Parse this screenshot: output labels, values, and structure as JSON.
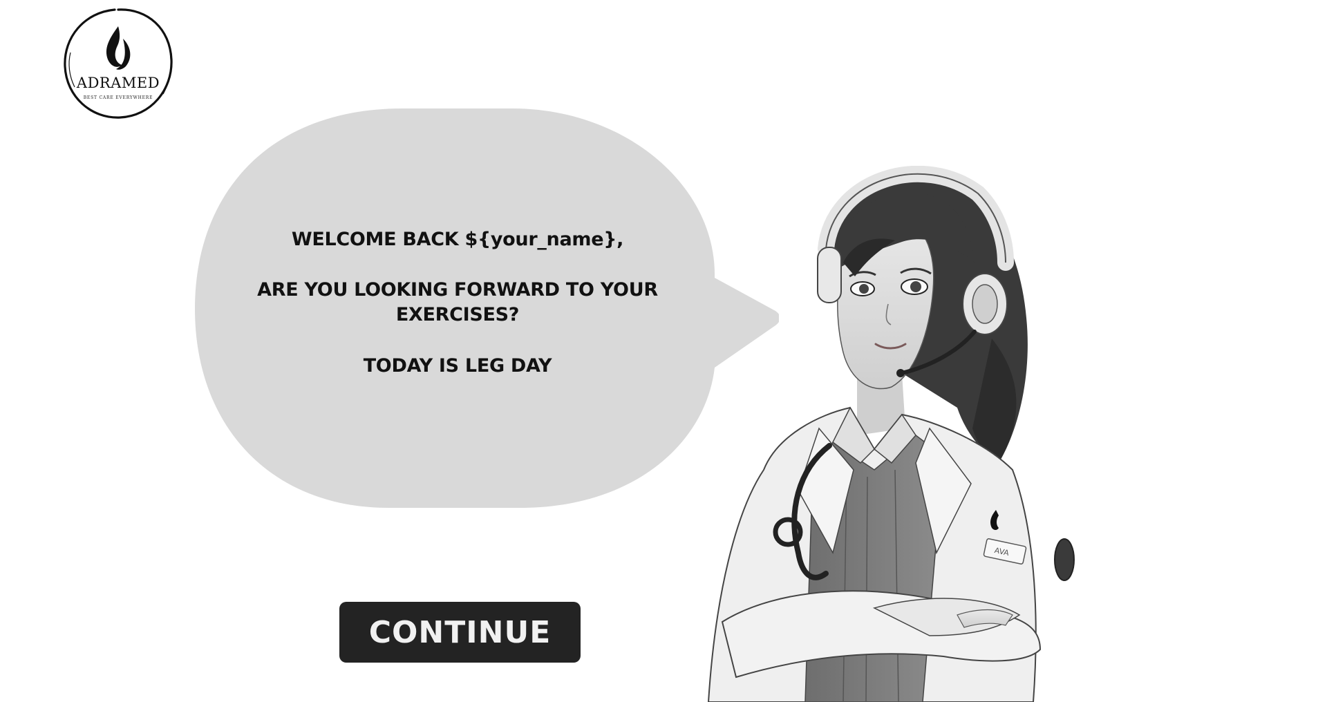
{
  "logo": {
    "name": "ADRAMED",
    "tagline": "BEST CARE EVERYWHERE"
  },
  "speech_bubble": {
    "line1": "WELCOME BACK ${your_name},",
    "line2": "ARE YOU LOOKING FORWARD TO YOUR EXERCISES?",
    "line3": "TODAY IS LEG DAY"
  },
  "continue_button": {
    "label": "CONTINUE"
  },
  "avatar": {
    "name_badge": "AVA"
  },
  "colors": {
    "background": "#ffffff",
    "bubble": "#d9d9d9",
    "button": "#232323",
    "button_text": "#f1f1f1"
  }
}
